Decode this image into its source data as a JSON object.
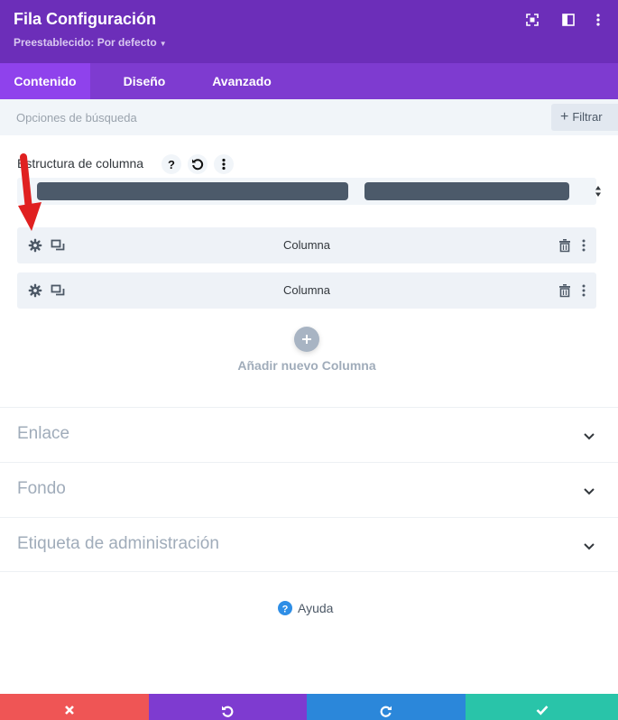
{
  "header": {
    "title": "Fila Configuración",
    "preset_label": "Preestablecido: Por defecto",
    "bg_color": "#6c2eb9",
    "icons": [
      "expand-icon",
      "split-view-icon",
      "more-vertical-icon"
    ]
  },
  "tabs": [
    {
      "label": "Contenido",
      "active": true
    },
    {
      "label": "Diseño",
      "active": false
    },
    {
      "label": "Avanzado",
      "active": false
    }
  ],
  "search": {
    "placeholder": "Opciones de búsqueda",
    "value": "",
    "filter_label": "Filtrar"
  },
  "column_structure": {
    "label": "Estructura de columna",
    "icons": [
      "help-icon",
      "reset-icon",
      "more-vertical-icon"
    ]
  },
  "columns": [
    {
      "label": "Columna"
    },
    {
      "label": "Columna"
    }
  ],
  "add_column": {
    "label": "Añadir nuevo Columna"
  },
  "sections": [
    {
      "label": "Enlace"
    },
    {
      "label": "Fondo"
    },
    {
      "label": "Etiqueta de administración"
    }
  ],
  "help": {
    "label": "Ayuda"
  },
  "footer": {
    "buttons": [
      {
        "name": "discard",
        "color": "#ef5555"
      },
      {
        "name": "undo",
        "color": "#7e3bd0"
      },
      {
        "name": "redo",
        "color": "#2b87da"
      },
      {
        "name": "save",
        "color": "#29c4a9"
      }
    ]
  },
  "annotation": {
    "color": "#e02020"
  }
}
